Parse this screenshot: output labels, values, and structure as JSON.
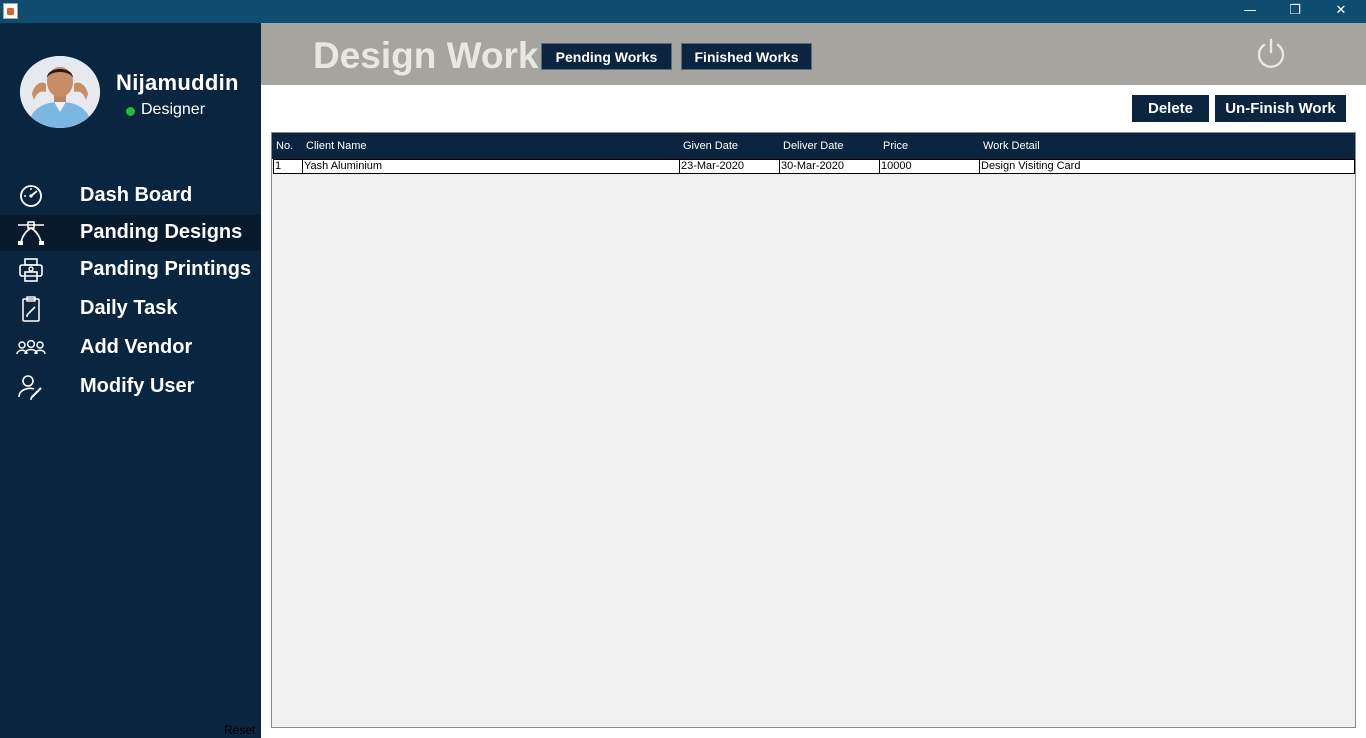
{
  "window": {
    "minimize_glyph": "—",
    "maximize_glyph": "❐",
    "close_glyph": "✕"
  },
  "user": {
    "name": "Nijamuddin",
    "role": "Designer",
    "status_color": "#22bb33"
  },
  "sidebar": {
    "items": [
      {
        "label": "Dash Board",
        "icon": "gauge-icon",
        "active": false
      },
      {
        "label": "Panding Designs",
        "icon": "bezier-pen-icon",
        "active": true
      },
      {
        "label": "Panding Printings",
        "icon": "printer-icon",
        "active": false
      },
      {
        "label": "Daily Task",
        "icon": "clipboard-pencil-icon",
        "active": false
      },
      {
        "label": "Add Vendor",
        "icon": "group-icon",
        "active": false
      },
      {
        "label": "Modify User",
        "icon": "user-edit-icon",
        "active": false
      }
    ],
    "reset_label": "Reset"
  },
  "header": {
    "title": "Design Work",
    "pending_label": "Pending Works",
    "finished_label": "Finished Works",
    "power_icon": "power-icon"
  },
  "actions": {
    "delete_label": "Delete",
    "unfinish_label": "Un-Finish Work"
  },
  "table": {
    "columns": [
      "No.",
      "Client Name",
      "Given Date",
      "Deliver Date",
      "Price",
      "Work Detail"
    ],
    "rows": [
      [
        "1",
        "Yash Aluminium",
        "23-Mar-2020",
        "30-Mar-2020",
        "10000",
        "Design Visiting Card"
      ]
    ]
  },
  "colors": {
    "sidebar_bg": "#0a2540",
    "header_bg": "#a6a49f",
    "button_bg": "#0b2540",
    "titlebar_bg": "#0e4d6f"
  }
}
